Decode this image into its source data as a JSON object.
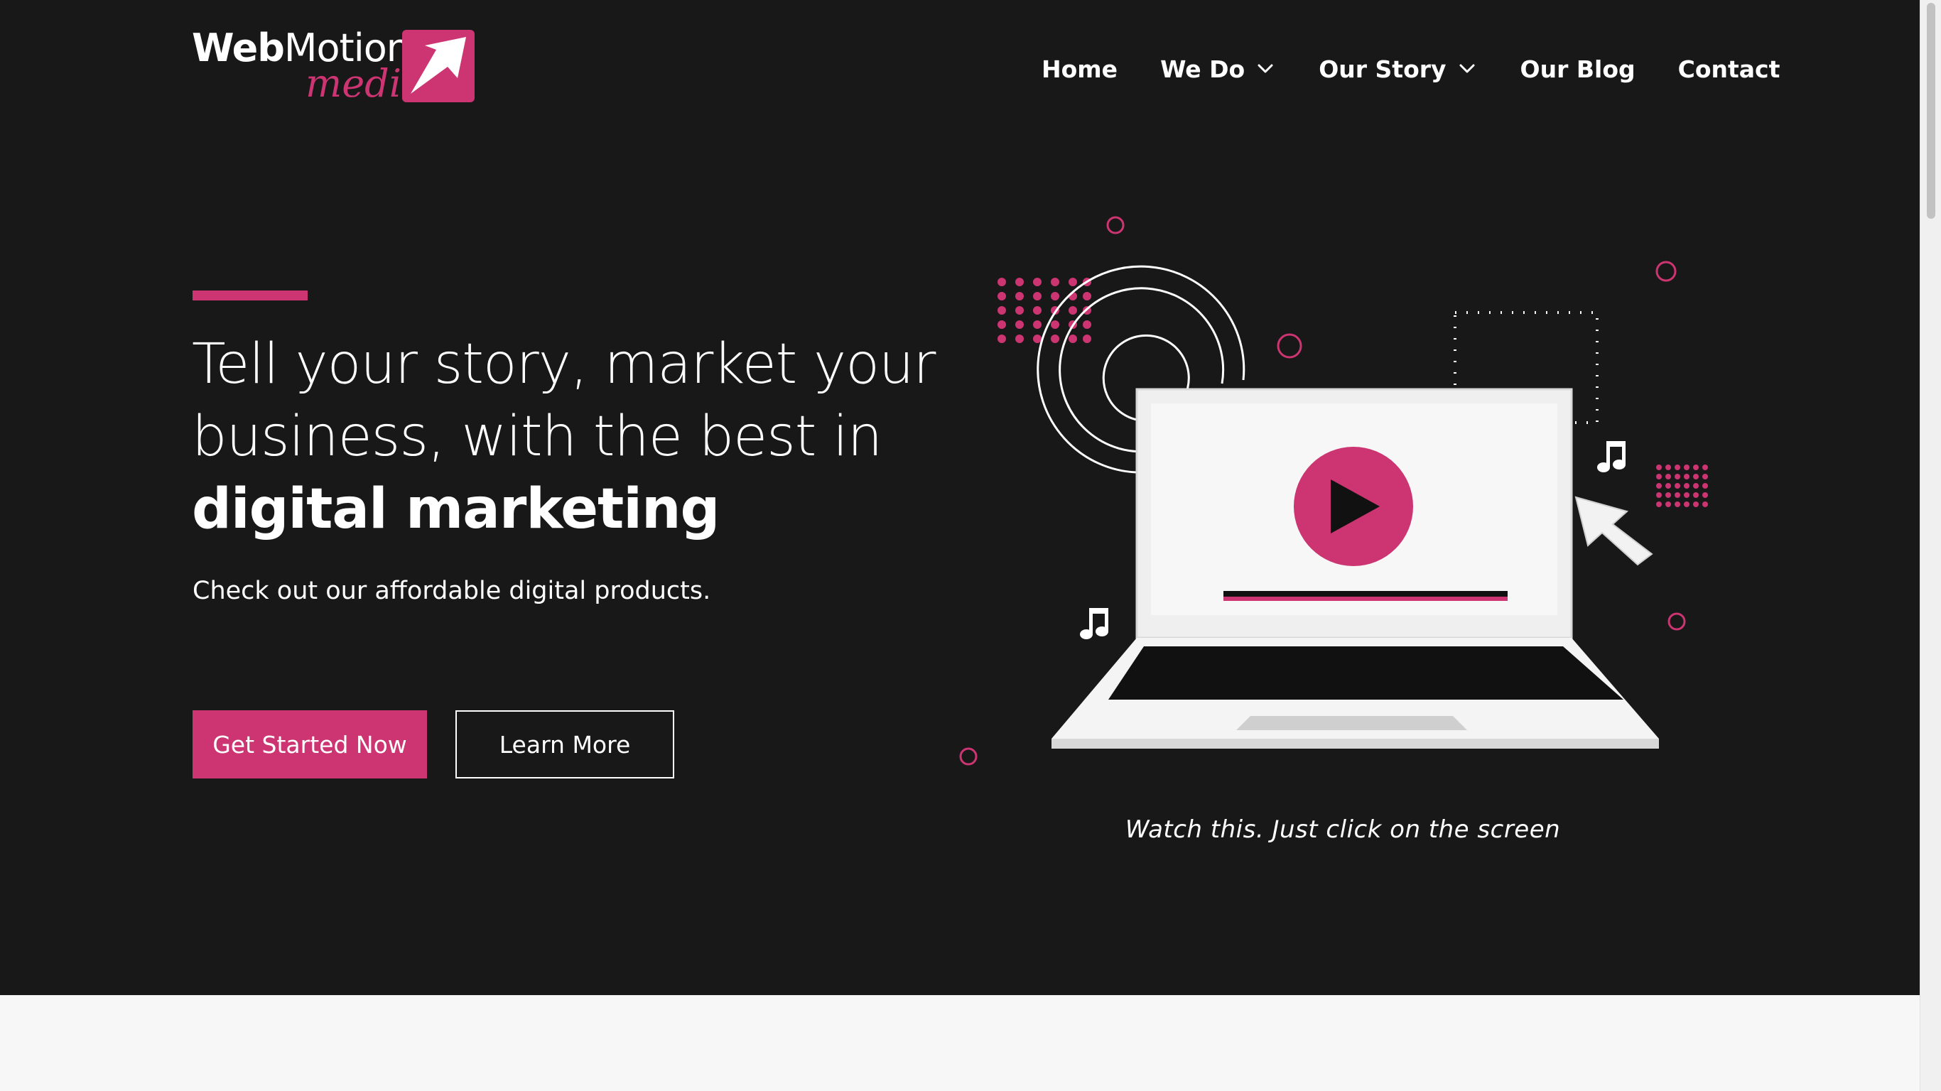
{
  "brand": {
    "name_bold": "Web",
    "name_light": "Motion",
    "name_script": "media",
    "accent_color": "#cc3572",
    "background": "#181818"
  },
  "nav": {
    "items": [
      {
        "label": "Home",
        "has_dropdown": false
      },
      {
        "label": "We Do",
        "has_dropdown": true
      },
      {
        "label": "Our Story",
        "has_dropdown": true
      },
      {
        "label": "Our Blog",
        "has_dropdown": false
      },
      {
        "label": "Contact",
        "has_dropdown": false
      }
    ]
  },
  "hero": {
    "headline_line1": "Tell your story, market your",
    "headline_line2": "business, with the best in",
    "headline_strong": "digital marketing",
    "subtext": "Check out our affordable digital products.",
    "primary_button": "Get Started Now",
    "secondary_button": "Learn More"
  },
  "video": {
    "caption": "Watch this. Just click on the screen",
    "icons": [
      "play-icon",
      "music-note-icon",
      "cursor-arrow-icon",
      "laptop-icon"
    ]
  }
}
